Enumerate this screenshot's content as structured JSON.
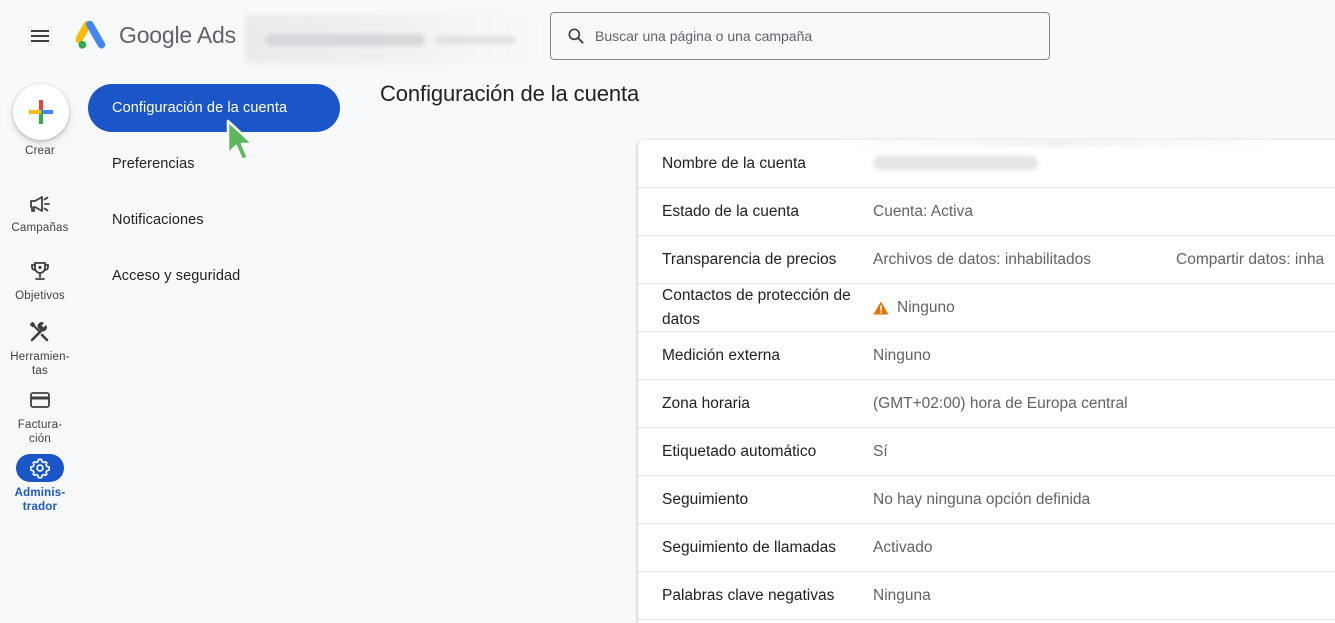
{
  "header": {
    "product_name": "Google Ads",
    "search_placeholder": "Buscar una página o una campaña",
    "icons": {
      "menu": "menu-icon",
      "logo": "google-ads-logo",
      "search": "search-icon"
    }
  },
  "rail": {
    "create_label": "Crear",
    "items": [
      {
        "label": "Campañas",
        "icon": "megaphone-icon"
      },
      {
        "label": "Objetivos",
        "icon": "trophy-icon"
      },
      {
        "label": "Herramien-\ntas",
        "icon": "tools-icon"
      },
      {
        "label": "Factura-\nción",
        "icon": "credit-card-icon"
      },
      {
        "label": "Adminis-\ntrador",
        "icon": "gear-icon"
      }
    ]
  },
  "subnav": {
    "items": [
      {
        "label": "Configuración de la cuenta",
        "active": true
      },
      {
        "label": "Preferencias",
        "active": false
      },
      {
        "label": "Notificaciones",
        "active": false
      },
      {
        "label": "Acceso y seguridad",
        "active": false
      }
    ]
  },
  "main": {
    "title": "Configuración de la cuenta",
    "settings": [
      {
        "label": "Nombre de la cuenta",
        "value": ""
      },
      {
        "label": "Estado de la cuenta",
        "value": "Cuenta: Activa"
      },
      {
        "label": "Transparencia de precios",
        "value": "Archivos de datos: inhabilitados",
        "value2": "Compartir datos: inha"
      },
      {
        "label": "Contactos de protección de datos",
        "value": "Ninguno",
        "icon": "warning-icon"
      },
      {
        "label": "Medición externa",
        "value": "Ninguno"
      },
      {
        "label": "Zona horaria",
        "value": "(GMT+02:00) hora de Europa central"
      },
      {
        "label": "Etiquetado automático",
        "value": "Sí"
      },
      {
        "label": "Seguimiento",
        "value": "No hay ninguna opción definida"
      },
      {
        "label": "Seguimiento de llamadas",
        "value": "Activado"
      },
      {
        "label": "Palabras clave negativas",
        "value": "Ninguna"
      }
    ]
  },
  "colors": {
    "accent": "#1a56c8",
    "background": "#f8f9fa",
    "warning": "#e37400",
    "cursor": "#5cb85c"
  }
}
